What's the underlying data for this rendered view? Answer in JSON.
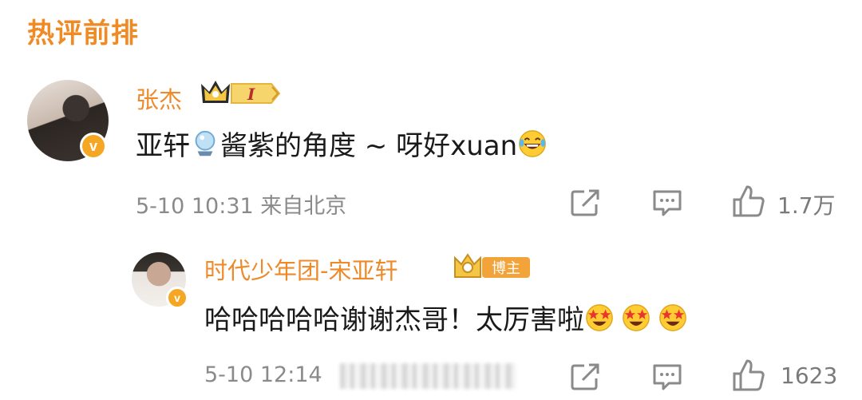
{
  "section": {
    "title": "热评前排"
  },
  "comment": {
    "username": "张杰",
    "badge_level": "I",
    "text_before": "亚轩",
    "text_middle": "酱紫的角度 ~ 呀好xuan",
    "timestamp": "5-10 10:31",
    "location": "来自北京",
    "likes": "1.7万"
  },
  "reply": {
    "username": "时代少年团-宋亚轩",
    "badge_label": "博主",
    "text": "哈哈哈哈哈谢谢杰哥！太厉害啦",
    "timestamp": "5-10 12:14",
    "likes": "1623"
  },
  "verify_mark": "v",
  "colors": {
    "accent": "#f08a24",
    "username": "#ee8a2a",
    "meta": "#8a8a8a",
    "verify": "#f5a623"
  },
  "icons": [
    "share-icon",
    "comment-icon",
    "like-icon",
    "crown-icon",
    "laugh-emoji",
    "star-eyes-emoji",
    "crystal-ball-emoji"
  ]
}
